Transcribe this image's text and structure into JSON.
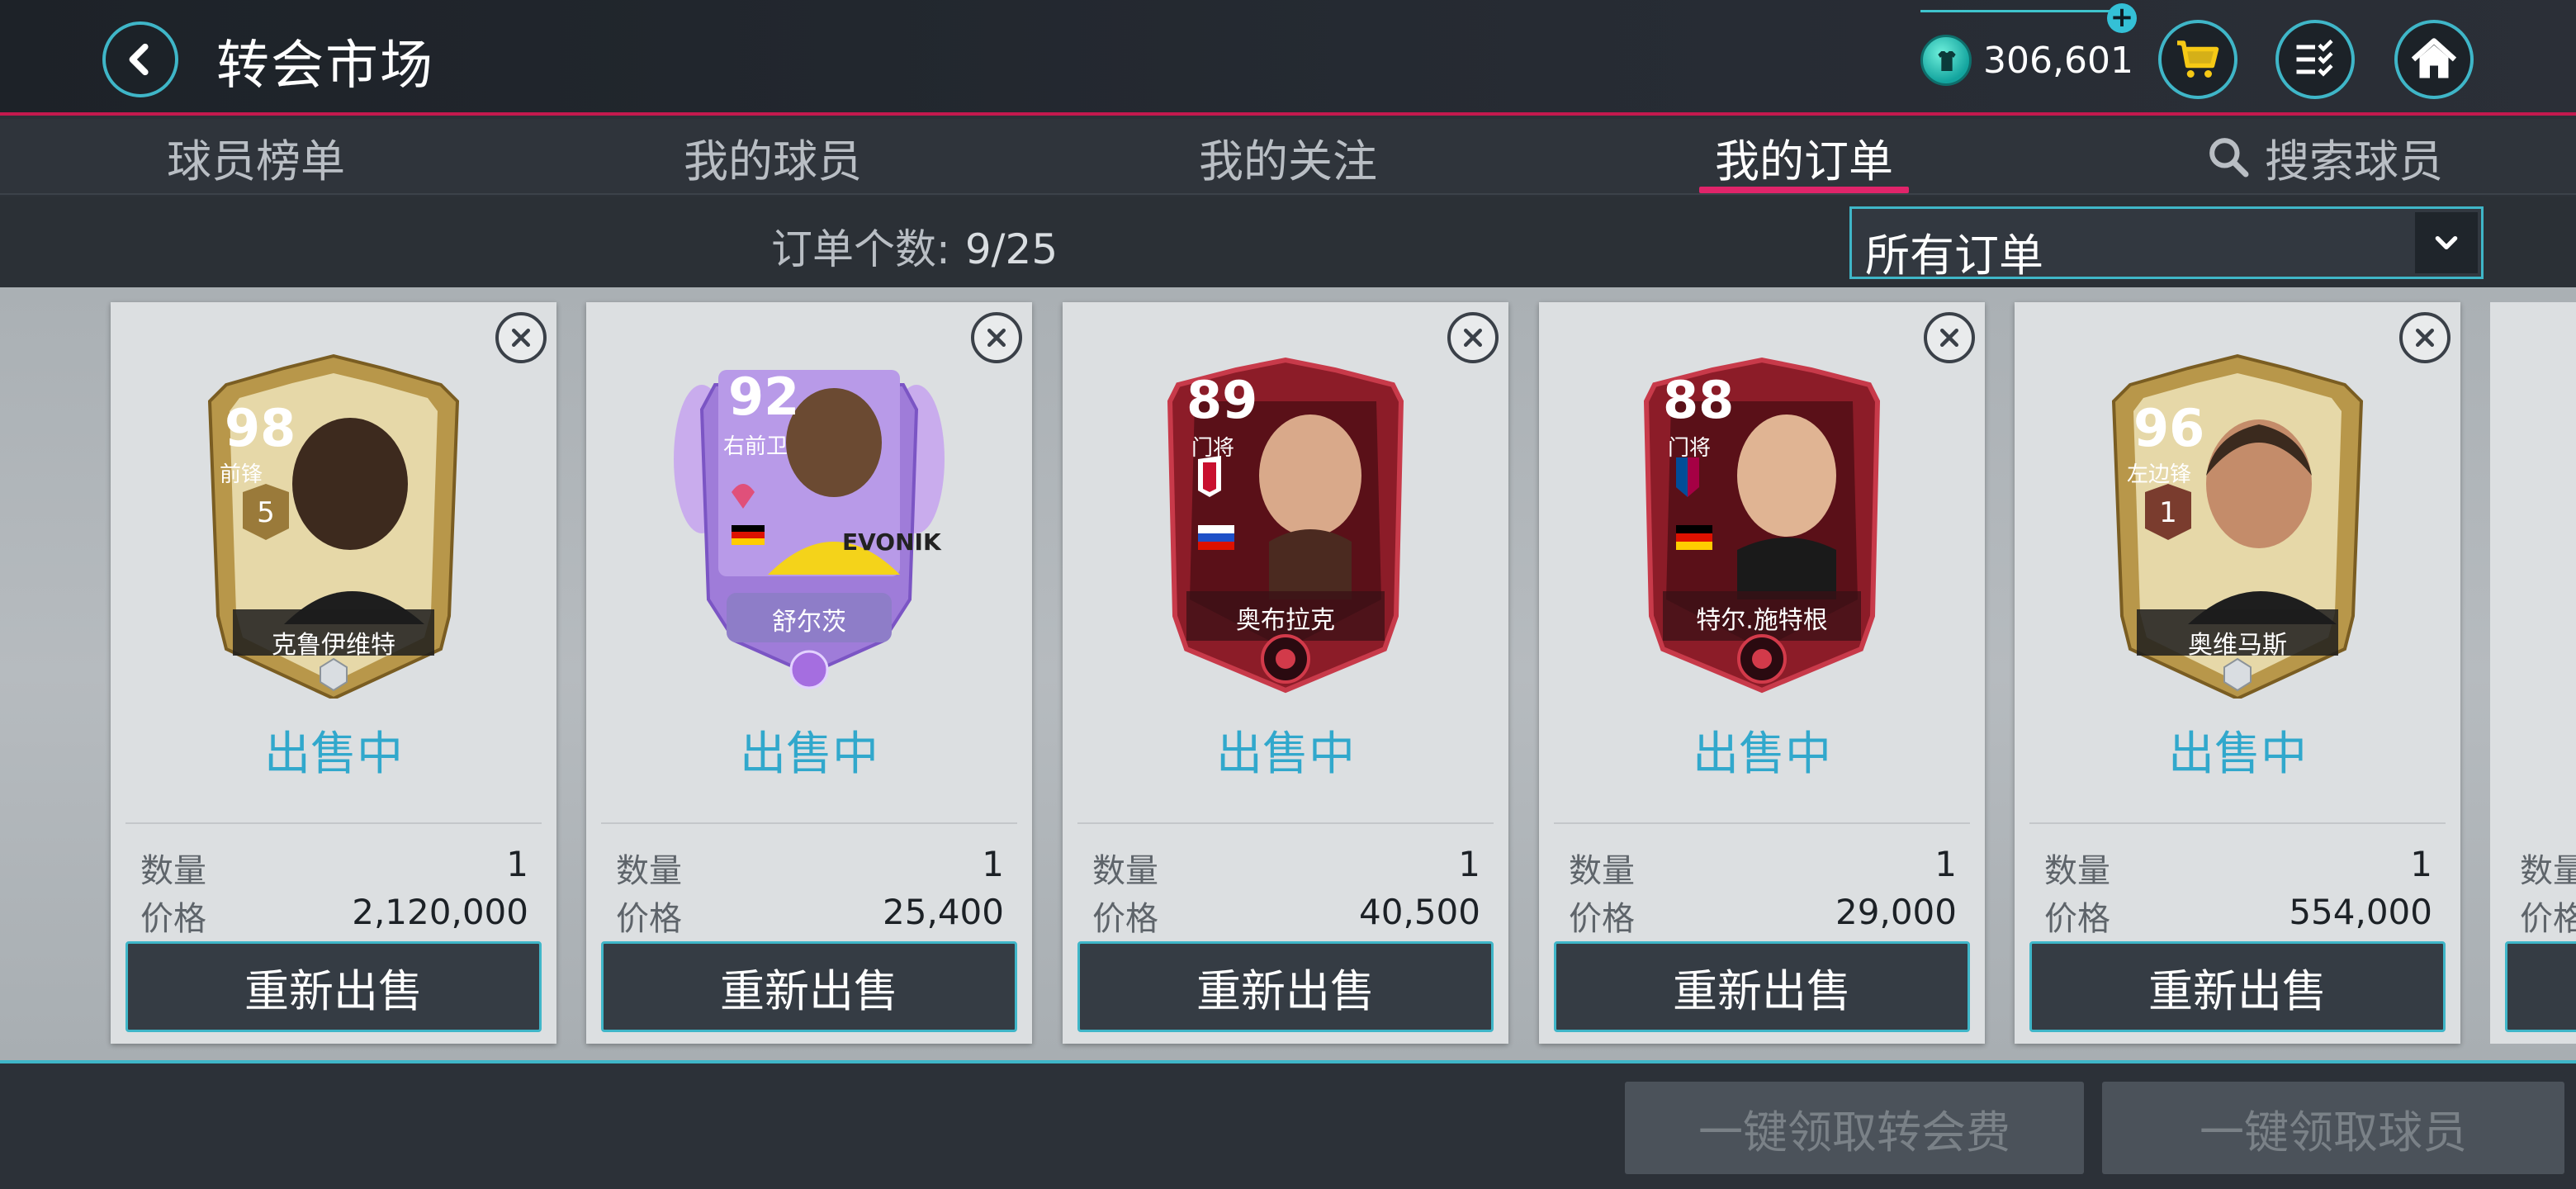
{
  "header": {
    "title": "转会市场",
    "coins": "306,601"
  },
  "tabs": [
    {
      "label": "球员榜单"
    },
    {
      "label": "我的球员"
    },
    {
      "label": "我的关注"
    },
    {
      "label": "我的订单"
    },
    {
      "label": "搜索球员"
    }
  ],
  "filter": {
    "count_label": "订单个数:",
    "count_value": "9/25",
    "dropdown_value": "所有订单"
  },
  "labels": {
    "quantity": "数量",
    "price": "价格",
    "resell": "重新出售"
  },
  "cards": [
    {
      "rating": "98",
      "position": "前锋",
      "name": "克鲁伊维特",
      "status": "出售中",
      "quantity": "1",
      "price": "2,120,000"
    },
    {
      "rating": "92",
      "position": "右前卫",
      "name": "舒尔茨",
      "status": "出售中",
      "quantity": "1",
      "price": "25,400"
    },
    {
      "rating": "89",
      "position": "门将",
      "name": "奥布拉克",
      "status": "出售中",
      "quantity": "1",
      "price": "40,500"
    },
    {
      "rating": "88",
      "position": "门将",
      "name": "特尔.施特根",
      "status": "出售中",
      "quantity": "1",
      "price": "29,000"
    },
    {
      "rating": "96",
      "position": "左边锋",
      "name": "奥维马斯",
      "status": "出售中",
      "quantity": "1",
      "price": "554,000"
    }
  ],
  "partial_card": {
    "quantity_label": "数量",
    "price_label": "价格"
  },
  "bottom": {
    "claim_fees": "一键领取转会费",
    "claim_players": "一键领取球员"
  }
}
